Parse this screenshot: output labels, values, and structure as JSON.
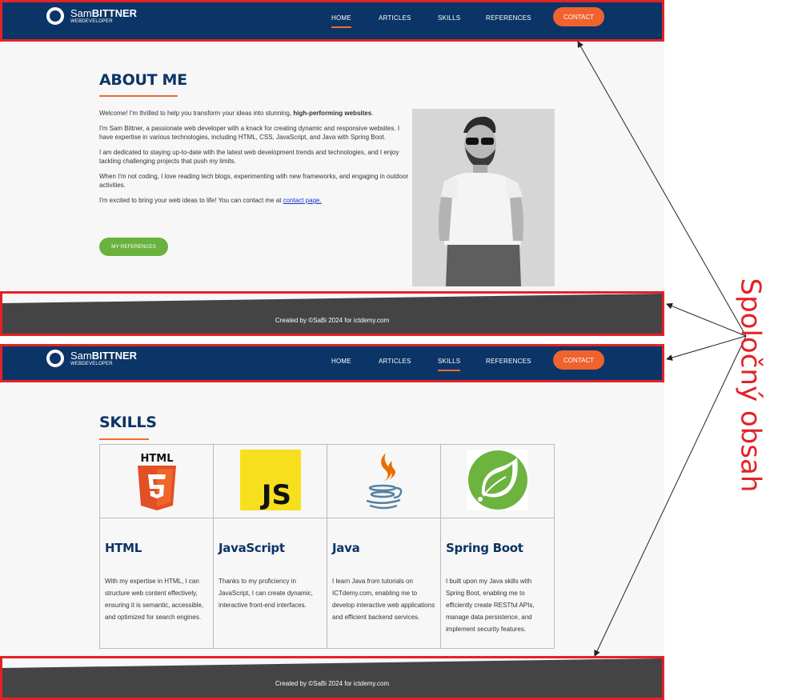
{
  "brand": {
    "name_first": "Sam",
    "name_last": "BITTNER",
    "subtitle": "WEBDEVELOPER"
  },
  "nav": {
    "items": [
      {
        "label": "HOME"
      },
      {
        "label": "ARTICLES"
      },
      {
        "label": "SKILLS"
      },
      {
        "label": "REFERENCES"
      }
    ],
    "contact_label": "CONTACT"
  },
  "about": {
    "title": "ABOUT ME",
    "p1_normal": "Welcome! I'm thrilled to help you transform your ideas into stunning, ",
    "p1_bold": "high-performing websites",
    "p1_end": ".",
    "p2": "I'm Sam Bittner, a passionate web developer with a knack for creating dynamic and responsive websites. I have expertise in various technologies, including HTML, CSS, JavaScript, and Java with Spring Boot.",
    "p3": "I am dedicated to staying up-to-date with the latest web development trends and technologies, and I enjoy tackling challenging projects that push my limits.",
    "p4": "When I'm not coding, I love reading tech blogs, experimenting with new frameworks, and engaging in outdoor activities.",
    "p5_normal": "I'm excited to bring your web ideas to life! You can contact me at ",
    "p5_link": "contact page.",
    "button": "MY REFERENCES"
  },
  "footer": {
    "text": "Created by ©SaBi 2024 for ictdemy.com"
  },
  "skills": {
    "title": "SKILLS",
    "items": [
      {
        "name": "HTML",
        "logo_text": "HTML",
        "desc": "With my expertise in HTML, I can structure web content effectively, ensuring it is semantic, accessible, and optimized for search engines."
      },
      {
        "name": "JavaScript",
        "logo_text": "JS",
        "desc": "Thanks to my proficiency in JavaScript, I can create dynamic, interactive front-end interfaces."
      },
      {
        "name": "Java",
        "desc": "I learn Java from tutorials on ICTdemy.com, enabling me to develop interactive web applications and efficient backend services."
      },
      {
        "name": "Spring Boot",
        "desc": "I built upon my Java skills with Spring Boot, enabling me to efficiently create RESTful APIs, manage data persistence, and implement security features."
      }
    ]
  },
  "annotation": {
    "label": "Spoločný obsah"
  },
  "colors": {
    "navy": "#0b3566",
    "orange": "#f0622e",
    "green": "#6ab23e",
    "footer": "#444444",
    "highlight": "#e32227"
  }
}
